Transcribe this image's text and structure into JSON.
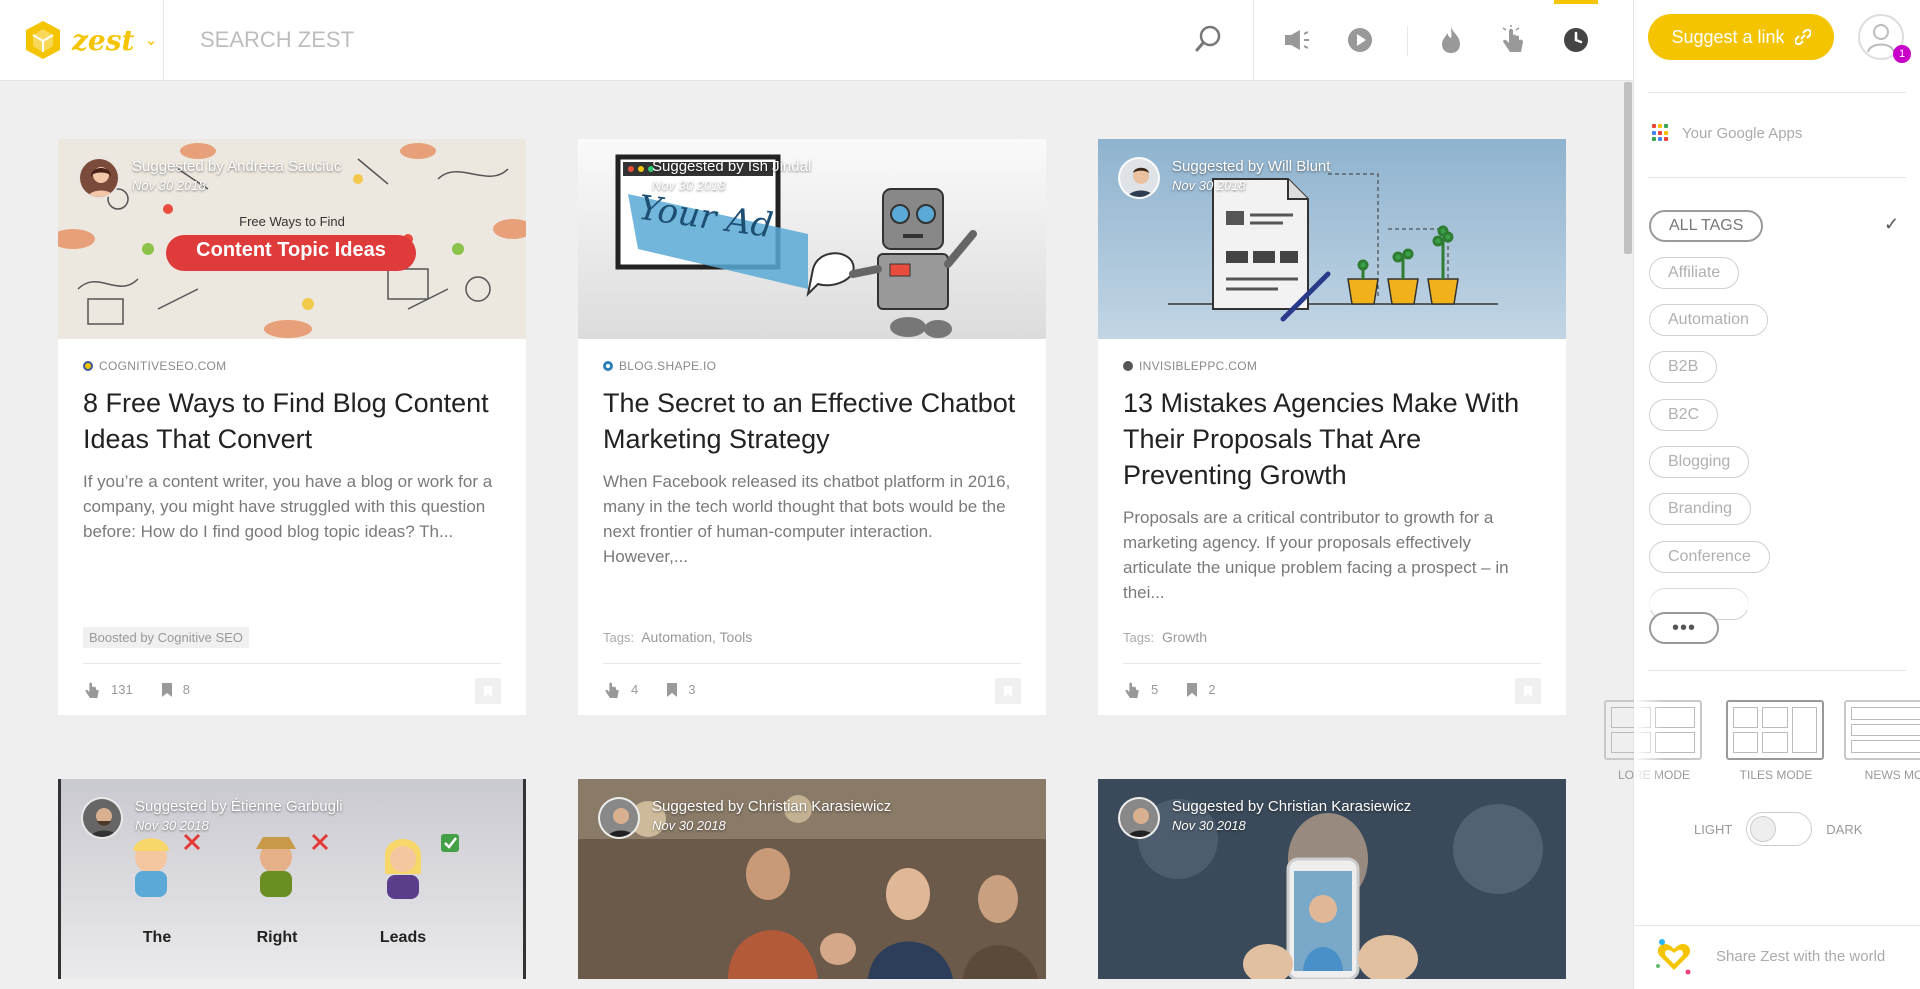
{
  "app": {
    "logo_text": "zest"
  },
  "search": {
    "placeholder": "SEARCH ZEST"
  },
  "topbar_icons": [
    "search-icon",
    "megaphone-icon",
    "play-icon",
    "flame-icon",
    "pointer-hand-icon",
    "clock-icon"
  ],
  "colors": {
    "brand": "#f5c400",
    "badge": "#c800c8"
  },
  "panel": {
    "suggest_label": "Suggest a link",
    "notification_count": "1",
    "google_apps": "Your Google Apps",
    "tags": [
      "ALL TAGS",
      "Affiliate",
      "Automation",
      "B2B",
      "B2C",
      "Blogging",
      "Branding",
      "Conference"
    ],
    "more_label": "•••",
    "modes": [
      "LORE MODE",
      "TILES MODE",
      "NEWS MO"
    ],
    "theme_light": "LIGHT",
    "theme_dark": "DARK",
    "share_text": "Share Zest with the world"
  },
  "cards": [
    {
      "suggested_by": "Suggested by Andreea Sauciuc",
      "date": "Nov 30 2018",
      "image_text_small": "Free Ways to Find",
      "image_text_big": "Content Topic Ideas",
      "source": "COGNITIVESEO.COM",
      "title": "8 Free Ways to Find Blog Content Ideas That Convert",
      "description": "If you’re a content writer, you have a blog or work for a company, you might have struggled with this question before: How do I find good blog topic ideas? Th...",
      "boost": "Boosted by Cognitive SEO",
      "clicks": "131",
      "saves": "8"
    },
    {
      "suggested_by": "Suggested by Ish Jindal",
      "date": "Nov 30 2018",
      "image_text_big": "Your Ad",
      "source": "BLOG.SHAPE.IO",
      "title": "The Secret to an Effective Chatbot Marketing Strategy",
      "description": "When Facebook released its chatbot platform in 2016, many in the tech world thought that bots would be the next frontier of human-computer interaction. However,...",
      "tags_label": "Tags:",
      "tags": "Automation, Tools",
      "clicks": "4",
      "saves": "3"
    },
    {
      "suggested_by": "Suggested by Will Blunt",
      "date": "Nov 30 2018",
      "source": "INVISIBLEPPC.COM",
      "title": "13 Mistakes Agencies Make With Their Proposals That Are Preventing Growth",
      "description": "Proposals are a critical contributor to growth for a marketing agency. If your proposals effectively articulate the unique problem facing a prospect – in thei...",
      "tags_label": "Tags:",
      "tags": "Growth",
      "clicks": "5",
      "saves": "2"
    },
    {
      "suggested_by": "Suggested by Étienne Garbugli",
      "date": "Nov 30 2018",
      "image_labels": [
        "The",
        "Right",
        "Leads"
      ]
    },
    {
      "suggested_by": "Suggested by Christian Karasiewicz",
      "date": "Nov 30 2018"
    },
    {
      "suggested_by": "Suggested by Christian Karasiewicz",
      "date": "Nov 30 2018"
    }
  ]
}
